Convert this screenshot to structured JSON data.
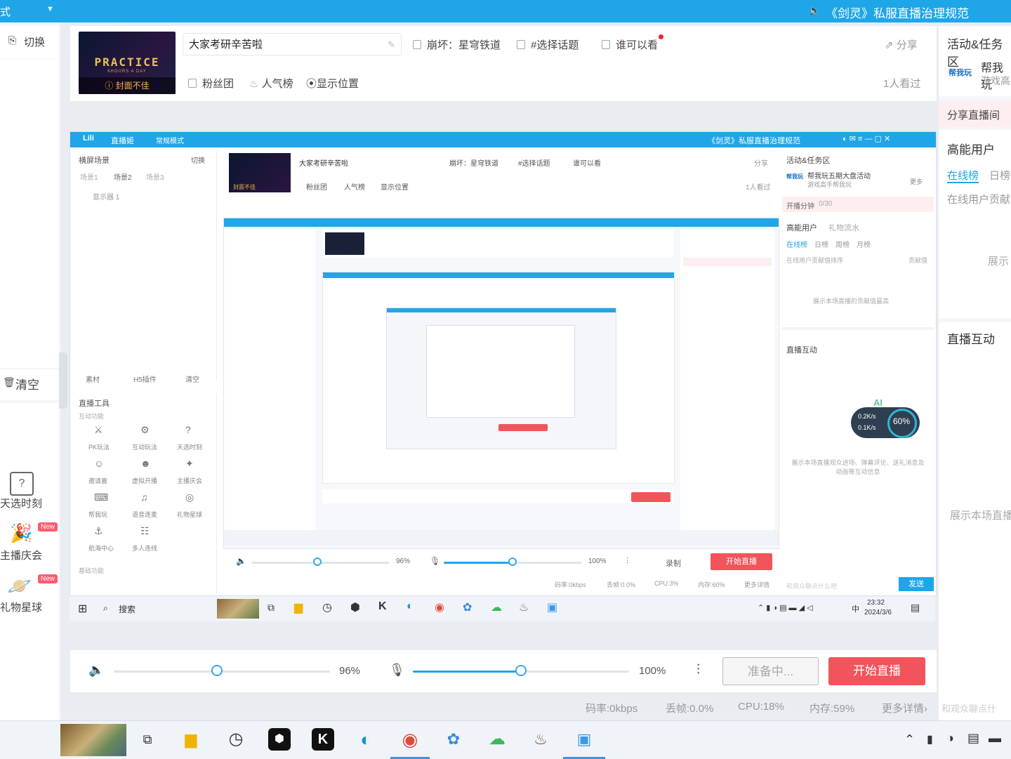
{
  "topbar": {
    "mode_partial": "式",
    "notice": "《剑灵》私服直播治理规范"
  },
  "left": {
    "switch_label": "切换",
    "clear_label": "清空",
    "tools": [
      {
        "label": "天选时刻",
        "is_new": false
      },
      {
        "label": "主播庆会",
        "is_new": true
      },
      {
        "label": "礼物星球",
        "is_new": true
      }
    ],
    "new_tag": "New"
  },
  "header": {
    "cover_text": "PRACTICE",
    "cover_sub": "6HOURS A DAY",
    "cover_warning": "封面不佳",
    "title": "大家考研辛苦啦",
    "category": "崩坏：星穹铁道",
    "topic": "#选择话题",
    "who_can_see": "谁可以看",
    "share": "分享",
    "fans_group": "粉丝团",
    "popularity": "人气榜",
    "show_location": "显示位置",
    "viewers": "1人看过"
  },
  "preview": {
    "logo": "Lili",
    "live_label": "直播姬",
    "mode": "常规模式",
    "notice": "《剑灵》私服直播治理规范",
    "scene_title": "横屏场景",
    "switch_label": "切换",
    "scenes": [
      "场景1",
      "场景2",
      "场景3"
    ],
    "source": "显示器 1",
    "bottom_tabs": [
      "素材",
      "H5插件",
      "清空"
    ],
    "tools_title": "直播工具",
    "tools_sub": "互动功能",
    "tools": [
      "PK玩法",
      "互动玩法",
      "天选时刻",
      "邀请嘉",
      "虚拟开播",
      "主播庆会",
      "帮我玩",
      "语音连麦",
      "礼物星球",
      "航海中心",
      "多人连线"
    ],
    "basic_sub": "基础功能",
    "header_title": "大家考研辛苦啦",
    "header_category": "崩坏：星穹铁道",
    "header_topic": "#选择话题",
    "header_who": "谁可以看",
    "header_share": "分享",
    "header_fans": "粉丝团",
    "header_pop": "人气榜",
    "header_loc": "显示位置",
    "header_viewers": "1人看过",
    "cover_warning": "封面不佳",
    "right_activity": "活动&任务区",
    "right_activity_text": "帮我玩五期大盘活动",
    "right_activity_sub": "游戏高手帮我玩",
    "right_more": "更多",
    "right_minutes": "开播分钟",
    "right_minutes_val": "0/30",
    "right_high_users": "高能用户",
    "right_gift_flow": "礼物流水",
    "right_tabs": [
      "在线榜",
      "日榜",
      "周榜",
      "月榜"
    ],
    "right_rank_desc": "在线用户贡献值排序",
    "right_contrib": "贡献值",
    "right_rank_empty": "展示本场直播的贡献值最高",
    "right_interact": "直播互动",
    "right_interact_empty": "展示本场直播观众进场、弹幕评论、送礼消息及动画等互动信息",
    "right_chat_placeholder": "和观众聊点什么吧",
    "right_send": "发送",
    "ai_label": "AI",
    "net_up": "0.2K/s",
    "net_down": "0.1K/s",
    "cpu_ring": "60%",
    "vol_pct": "96%",
    "mic_pct": "100%",
    "record": "录制",
    "start": "开始直播",
    "status": [
      "码率:0kbps",
      "丢帧:0.0%",
      "CPU:3%",
      "内存:60%",
      "更多详情"
    ],
    "taskbar_search": "搜索",
    "clock_time": "23:32",
    "clock_date": "2024/3/6",
    "ime": "中"
  },
  "controls": {
    "volume_pct": "96%",
    "volume_value": 0.96,
    "mic_pct": "100%",
    "mic_value": 1.0,
    "ready_label": "准备中...",
    "start_label": "开始直播"
  },
  "statusbar": {
    "bitrate": "码率:0kbps",
    "dropped": "丢帧:0.0%",
    "cpu": "CPU:18%",
    "memory": "内存:59%",
    "more": "更多详情"
  },
  "right": {
    "activity_title": "活动&任务区",
    "activity_text": "帮我玩",
    "activity_sub": "游戏高",
    "share_room": "分享直播间",
    "high_users": "高能用户",
    "tab_online": "在线榜",
    "tab_daily": "日榜",
    "online_contrib": "在线用户贡献",
    "show_partial": "展示",
    "interact_title": "直播互动",
    "interact_empty": "展示本场直播",
    "chat_placeholder": "和观众聊点什"
  },
  "colors": {
    "accent": "#1fa6e8",
    "live_red": "#f2545b",
    "new_tag": "#ff5a6e"
  }
}
